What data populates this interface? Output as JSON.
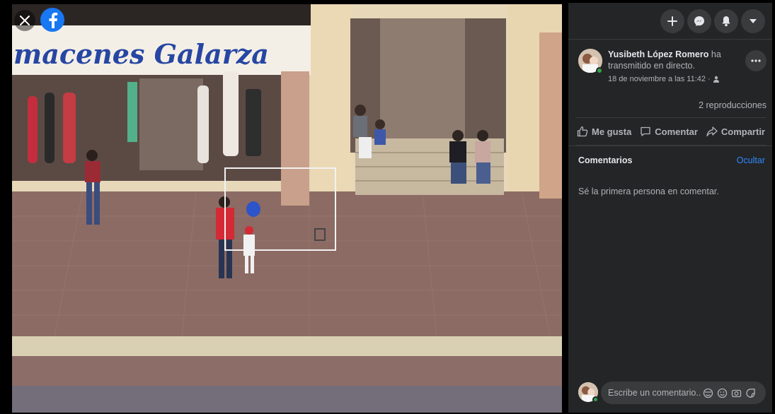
{
  "viewer": {
    "close_icon": "close-icon",
    "logo_icon": "facebook-logo-icon",
    "video_alt": "live video of a storefront and sidewalk",
    "sign_text": "macenes Galarza"
  },
  "topbar": {
    "icons": [
      "plus-icon",
      "messenger-icon",
      "bell-icon",
      "caret-down-icon"
    ]
  },
  "post": {
    "author": "Yusibeth López Romero",
    "action_text": "ha transmitido en directo.",
    "timestamp": "18 de noviembre a las 11:42 ·",
    "privacy_icon": "friends-icon",
    "more_icon": "more-dots-icon"
  },
  "stats": {
    "views": "2 reproducciones"
  },
  "actions": {
    "like": "Me gusta",
    "comment": "Comentar",
    "share": "Compartir"
  },
  "comments": {
    "title": "Comentarios",
    "hide": "Ocultar",
    "empty": "Sé la primera persona en comentar."
  },
  "composer": {
    "placeholder": "Escribe un comentario...",
    "icons": [
      "avatar-sticker-icon",
      "emoji-icon",
      "camera-icon",
      "sticker-icon"
    ]
  },
  "colors": {
    "panel_bg": "#242526",
    "button_bg": "#3a3b3c",
    "text_primary": "#e4e6eb",
    "text_secondary": "#b0b3b8",
    "link": "#2d88ff",
    "facebook_blue": "#1877f2",
    "online_green": "#31a24c"
  }
}
